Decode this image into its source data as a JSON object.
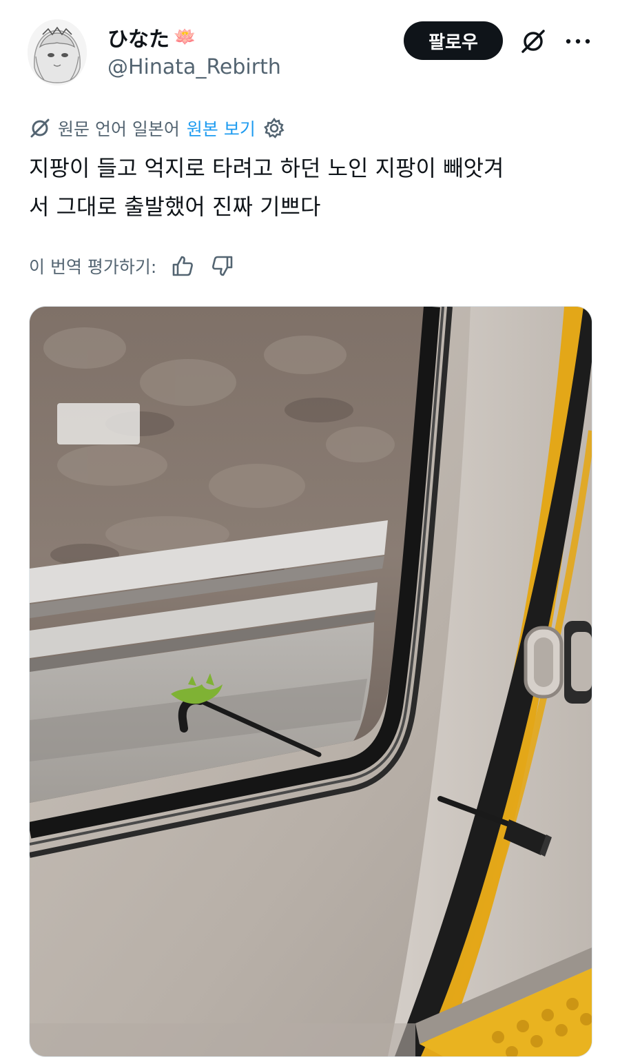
{
  "user": {
    "display_name": "ひなた",
    "emoji": "🪷",
    "handle": "@Hinata_Rebirth"
  },
  "actions": {
    "follow_label": "팔로우",
    "grok_icon": "grok-icon",
    "more_icon": "more-icon"
  },
  "translation": {
    "source_language": "원문 언어 일본어",
    "show_original": "원본 보기",
    "settings_icon": "gear-icon"
  },
  "tweet": {
    "text_line1": "지팡이 들고 억지로 타려고 하던 노인 지팡이 빼앗겨",
    "text_line2": "서 그대로 출발했어 진짜 기쁘다"
  },
  "rate": {
    "label": "이 번역 평가하기:",
    "like_icon": "thumbs-up-icon",
    "dislike_icon": "thumbs-down-icon"
  },
  "colors": {
    "text": "#0f1419",
    "secondary": "#536471",
    "link": "#1d9bf0",
    "button_bg": "#0f1419",
    "door_stripe": "#e3a718"
  }
}
